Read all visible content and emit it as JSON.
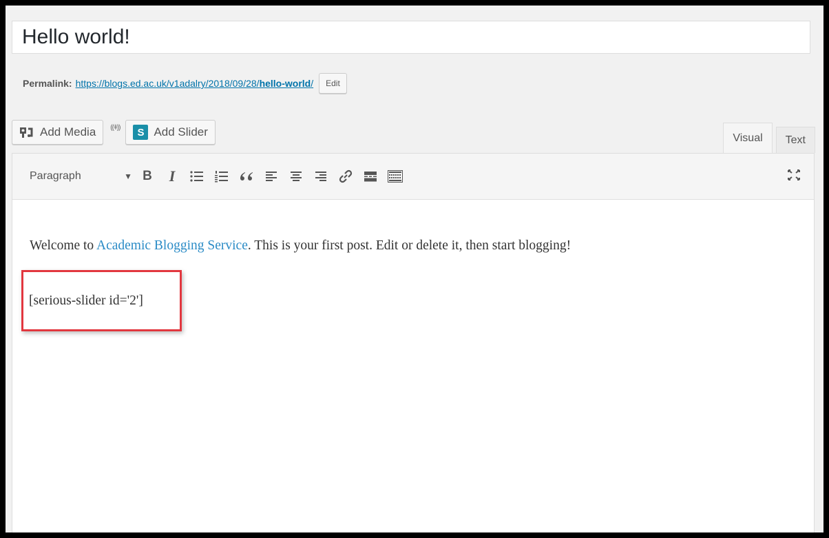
{
  "post": {
    "title": "Hello world!"
  },
  "permalink": {
    "label": "Permalink:",
    "url_base": "https://blogs.ed.ac.uk/v1adalry/2018/09/28/",
    "slug": "hello-world",
    "url_end": "/",
    "edit_label": "Edit"
  },
  "media_buttons": {
    "add_media": "Add Media",
    "add_slider": "Add Slider",
    "slider_badge": "S"
  },
  "tabs": {
    "visual": "Visual",
    "text": "Text",
    "active": "Visual"
  },
  "toolbar": {
    "format_value": "Paragraph",
    "icons": [
      "bold-icon",
      "italic-icon",
      "bulleted-list-icon",
      "numbered-list-icon",
      "blockquote-icon",
      "align-left-icon",
      "align-center-icon",
      "align-right-icon",
      "link-icon",
      "read-more-icon",
      "toolbar-toggle-icon"
    ],
    "bold_glyph": "B",
    "italic_glyph": "I"
  },
  "content": {
    "intro_before": "Welcome to ",
    "link_text": "Academic Blogging Service",
    "intro_after": ". This is your first post. Edit or delete it, then start blogging!",
    "shortcode": "[serious-slider id='2']"
  },
  "colors": {
    "link": "#0073aa",
    "content_link": "#2a8bc6",
    "highlight": "#e2373f",
    "slider_badge": "#1a8fa8"
  }
}
